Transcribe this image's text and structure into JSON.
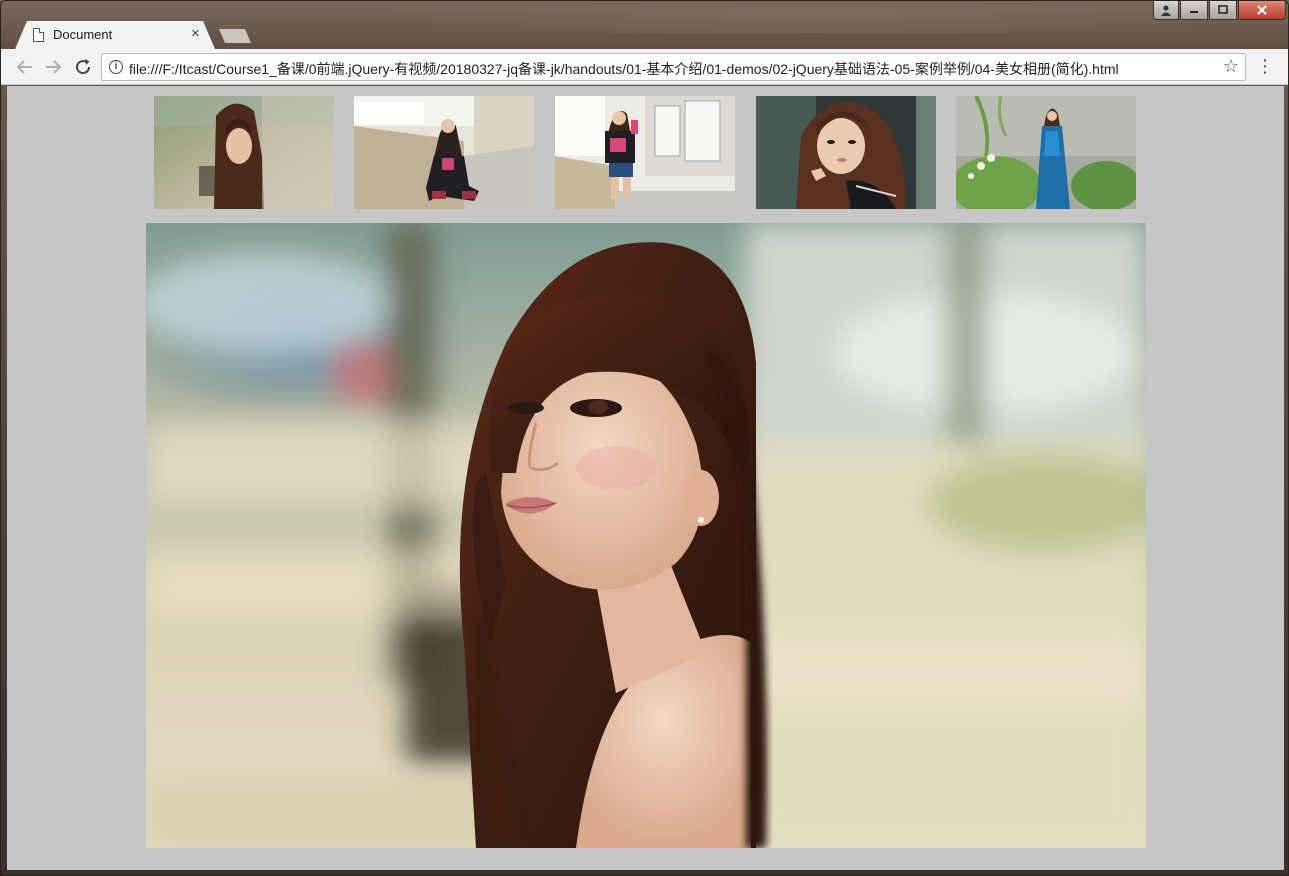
{
  "browser": {
    "tab_title": "Document",
    "tab_close": "×",
    "url": "file:///F:/Itcast/Course1_备课/0前端.jQuery-有视频/20180327-jq备课-jk/handouts/01-基本介绍/01-demos/02-jQuery基础语法-05-案例举例/04-美女相册(简化).html",
    "icons": {
      "back": "back-arrow-icon",
      "forward": "forward-arrow-icon",
      "reload": "reload-icon",
      "info": "info-icon",
      "bookmark": "star-icon",
      "menu": "kebab-menu-icon"
    }
  },
  "window_controls": {
    "user": "user-icon",
    "minimize": "minimize-icon",
    "maximize": "maximize-icon",
    "close": "close-icon"
  },
  "gallery": {
    "background": "#c6c6c6",
    "thumbnails": [
      {
        "subject": "woman portrait on bench, green blurred background"
      },
      {
        "subject": "woman sitting in corridor, black top"
      },
      {
        "subject": "woman standing in corridor, pink gloves"
      },
      {
        "subject": "woman close-up, dark background"
      },
      {
        "subject": "woman in blue dress among plants"
      }
    ],
    "main_image": {
      "subject": "woman with long brown hair, blurred outdoor background"
    }
  }
}
